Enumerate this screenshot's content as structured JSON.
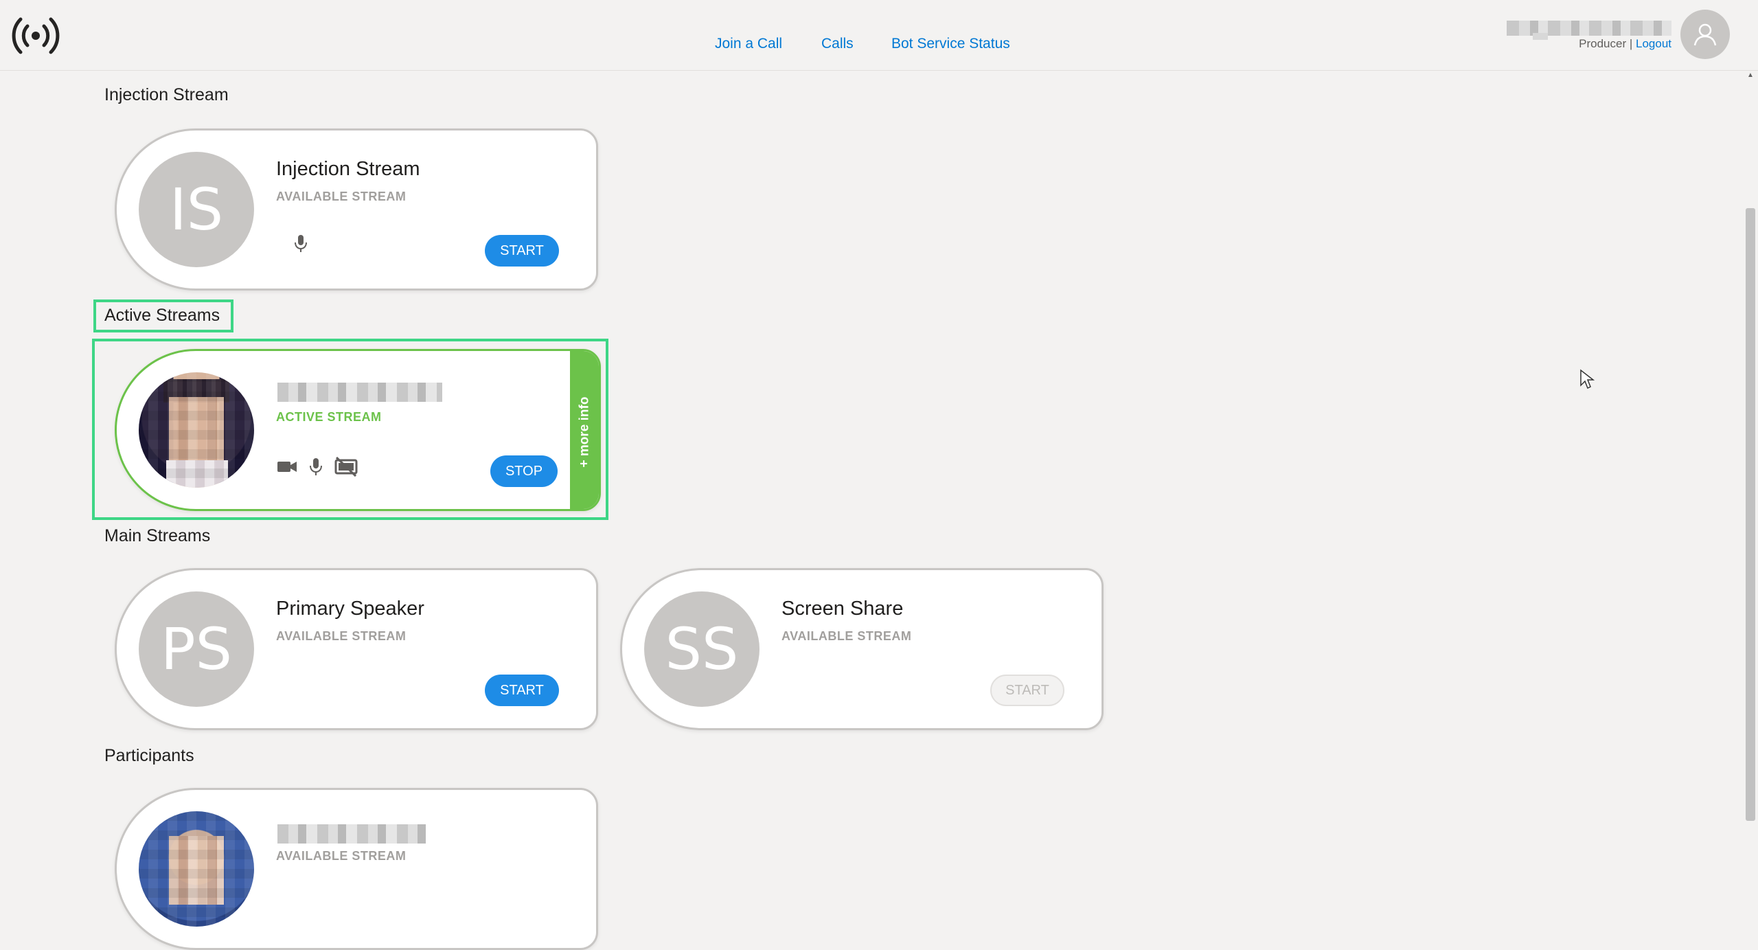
{
  "header": {
    "nav": [
      {
        "label": "Join a Call"
      },
      {
        "label": "Calls"
      },
      {
        "label": "Bot Service Status"
      }
    ],
    "user": {
      "role": "Producer",
      "separator": "|",
      "logout_label": "Logout"
    }
  },
  "sections": {
    "injection": {
      "title": "Injection Stream",
      "card": {
        "initials": "IS",
        "name": "Injection Stream",
        "status": "AVAILABLE STREAM",
        "button": "START",
        "icons": [
          "microphone-icon"
        ]
      }
    },
    "active": {
      "title": "Active Streams",
      "card": {
        "status": "ACTIVE STREAM",
        "button": "STOP",
        "more_info": "+ more info",
        "icons": [
          "video-camera-icon",
          "microphone-icon",
          "screen-share-off-icon"
        ]
      }
    },
    "main": {
      "title": "Main Streams",
      "cards": [
        {
          "initials": "PS",
          "name": "Primary Speaker",
          "status": "AVAILABLE STREAM",
          "button": "START",
          "disabled": false
        },
        {
          "initials": "SS",
          "name": "Screen Share",
          "status": "AVAILABLE STREAM",
          "button": "START",
          "disabled": true
        }
      ]
    },
    "participants": {
      "title": "Participants",
      "card": {
        "status": "AVAILABLE STREAM"
      }
    }
  },
  "colors": {
    "accent": "#1e8ce6",
    "active": "#6cc24a",
    "highlight": "#3ed686",
    "avatar_bg": "#c8c6c4"
  }
}
